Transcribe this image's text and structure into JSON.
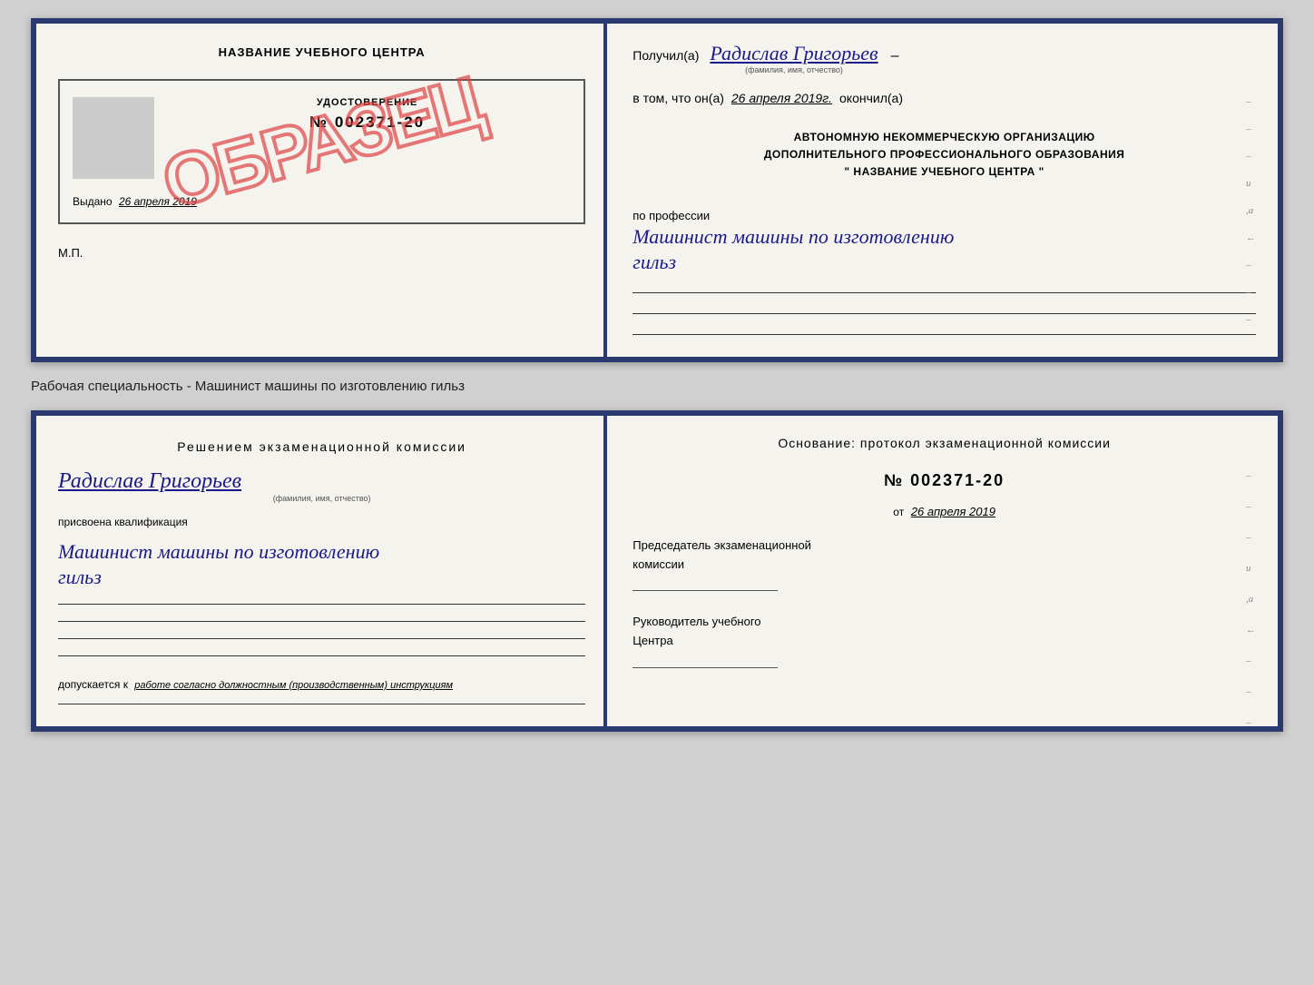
{
  "top_doc": {
    "left": {
      "center_title": "НАЗВАНИЕ УЧЕБНОГО ЦЕНТРА",
      "cert_subtitle": "УДОСТОВЕРЕНИЕ",
      "cert_number": "№ 002371-20",
      "issued_label": "Выдано",
      "issued_date": "26 апреля 2019",
      "mp_label": "М.П.",
      "stamp_text": "ОБРАЗЕЦ"
    },
    "right": {
      "received_label": "Получил(а)",
      "name": "Радислав Григорьев",
      "name_caption": "(фамилия, имя, отчество)",
      "date_prefix": "в том, что он(а)",
      "date_value": "26 апреля 2019г.",
      "date_suffix": "окончил(а)",
      "org_line1": "АВТОНОМНУЮ НЕКОММЕРЧЕСКУЮ ОРГАНИЗАЦИЮ",
      "org_line2": "ДОПОЛНИТЕЛЬНОГО ПРОФЕССИОНАЛЬНОГО ОБРАЗОВАНИЯ",
      "org_line3": "\" НАЗВАНИЕ УЧЕБНОГО ЦЕНТРА \"",
      "profession_label": "по профессии",
      "profession_text": "Машинист машины по изготовлению",
      "profession_text2": "гильз"
    }
  },
  "specialty_label": "Рабочая специальность - Машинист машины по изготовлению гильз",
  "bottom_doc": {
    "left": {
      "decision_title": "Решением  экзаменационной  комиссии",
      "name": "Радислав Григорьев",
      "name_caption": "(фамилия, имя, отчество)",
      "qualification_label": "присвоена квалификация",
      "qualification_text": "Машинист машины по изготовлению",
      "qualification_text2": "гильз",
      "admission_label": "допускается к",
      "admission_text": "работе согласно должностным (производственным) инструкциям"
    },
    "right": {
      "basis_label": "Основание: протокол экзаменационной  комиссии",
      "protocol_number": "№  002371-20",
      "date_prefix": "от",
      "date_value": "26 апреля 2019",
      "chairman_label": "Председатель экзаменационной",
      "chairman_label2": "комиссии",
      "director_label": "Руководитель учебного",
      "director_label2": "Центра"
    }
  },
  "edge_labels": {
    "top_right": [
      "–",
      "–",
      "–",
      "и",
      ",а",
      "←",
      "–",
      "–",
      "–"
    ],
    "bottom_right": [
      "–",
      "–",
      "–",
      "и",
      "а",
      "←",
      "–",
      "–",
      "–"
    ]
  }
}
